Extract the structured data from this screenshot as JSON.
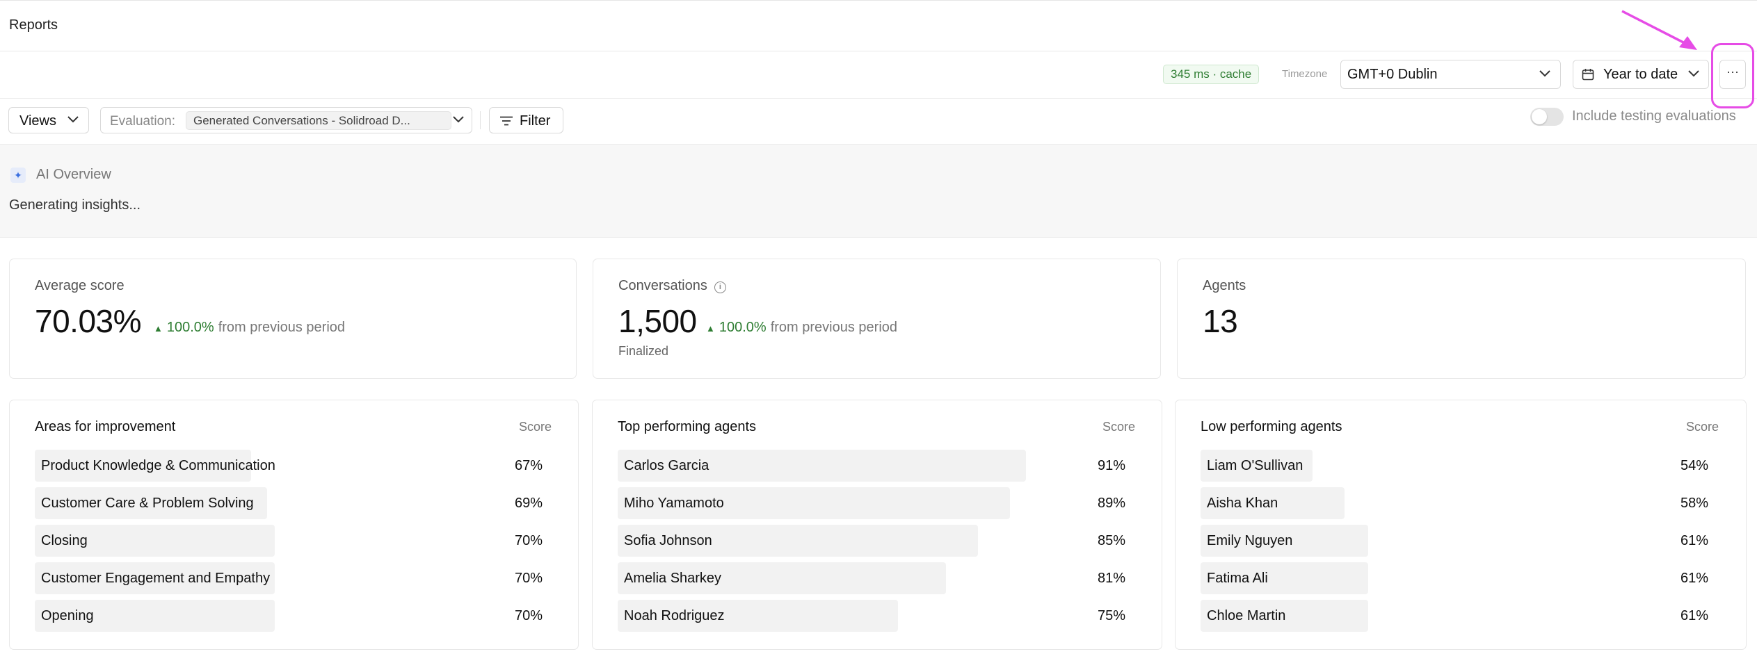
{
  "header": {
    "title": "Reports"
  },
  "toolbar": {
    "latency_badge": "345 ms · cache",
    "timezone_label": "Timezone",
    "timezone_value": "GMT+0 Dublin",
    "date_range_value": "Year to date",
    "more_label": "···"
  },
  "filters": {
    "views_label": "Views",
    "evaluation_label": "Evaluation:",
    "evaluation_value": "Generated Conversations - Solidroad D...",
    "filter_label": "Filter",
    "include_testing_label": "Include testing evaluations",
    "include_testing_enabled": false
  },
  "ai_overview": {
    "title": "AI Overview",
    "text": "Generating insights..."
  },
  "kpis": [
    {
      "title": "Average score",
      "value": "70.03%",
      "delta": "100.0%",
      "delta_text": "from previous period"
    },
    {
      "title": "Conversations",
      "value": "1,500",
      "delta": "100.0%",
      "delta_text": "from previous period",
      "sub": "Finalized"
    },
    {
      "title": "Agents",
      "value": "13"
    }
  ],
  "lists": [
    {
      "title": "Areas for improvement",
      "score_header": "Score",
      "rows": [
        {
          "name": "Product Knowledge & Communication",
          "value": "67%",
          "pct": 67
        },
        {
          "name": "Customer Care & Problem Solving",
          "value": "69%",
          "pct": 69
        },
        {
          "name": "Closing",
          "value": "70%",
          "pct": 70
        },
        {
          "name": "Customer Engagement and Empathy",
          "value": "70%",
          "pct": 70
        },
        {
          "name": "Opening",
          "value": "70%",
          "pct": 70
        }
      ]
    },
    {
      "title": "Top performing agents",
      "score_header": "Score",
      "rows": [
        {
          "name": "Carlos Garcia",
          "value": "91%",
          "pct": 91
        },
        {
          "name": "Miho Yamamoto",
          "value": "89%",
          "pct": 89
        },
        {
          "name": "Sofia Johnson",
          "value": "85%",
          "pct": 85
        },
        {
          "name": "Amelia Sharkey",
          "value": "81%",
          "pct": 81
        },
        {
          "name": "Noah Rodriguez",
          "value": "75%",
          "pct": 75
        }
      ]
    },
    {
      "title": "Low performing agents",
      "score_header": "Score",
      "rows": [
        {
          "name": "Liam O'Sullivan",
          "value": "54%",
          "pct": 54
        },
        {
          "name": "Aisha Khan",
          "value": "58%",
          "pct": 58
        },
        {
          "name": "Emily Nguyen",
          "value": "61%",
          "pct": 61
        },
        {
          "name": "Fatima Ali",
          "value": "61%",
          "pct": 61
        },
        {
          "name": "Chloe Martin",
          "value": "61%",
          "pct": 61
        }
      ]
    }
  ],
  "colors": {
    "accent_highlight": "#e64ce6",
    "positive": "#2e7d32",
    "bar": "#f2f2f2"
  }
}
